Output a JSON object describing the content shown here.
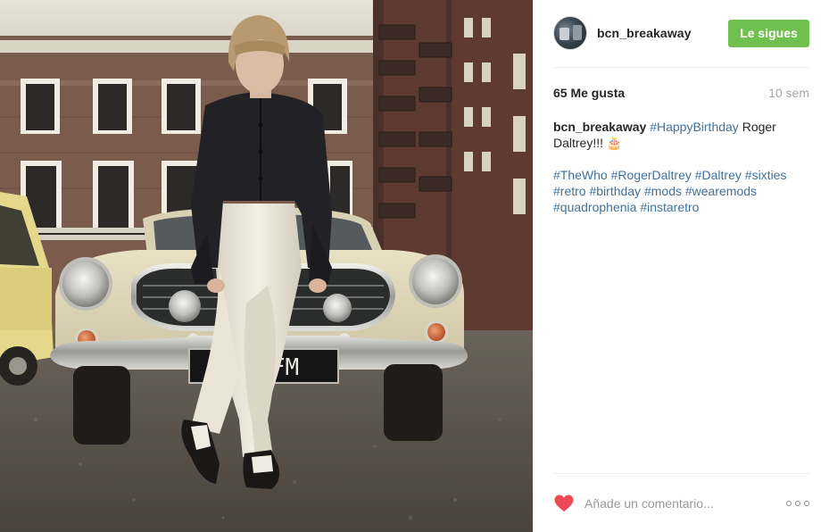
{
  "post": {
    "username": "bcn_breakaway",
    "follow_label": "Le sigues",
    "likes": "65 Me gusta",
    "time": "10 sem",
    "caption": {
      "author": "bcn_breakaway",
      "line1_tag": "#HappyBirthday",
      "line1_text": " Roger Daltrey!!! 🎂",
      "tags": [
        "#TheWho",
        "#RogerDaltrey",
        "#Daltrey",
        "#sixties",
        "#retro",
        "#birthday",
        "#mods",
        "#wearemods",
        "#quadrophenia",
        "#instaretro"
      ]
    },
    "comment_placeholder": "Añade un comentario...",
    "photo": {
      "plate_text": "8 YFM"
    }
  },
  "icons": {
    "like": "heart-icon",
    "more": "more-options-icon",
    "avatar": "profile-avatar"
  },
  "colors": {
    "follow_button": "#70c050",
    "hashtag": "#3f729b",
    "like_heart": "#ed4956",
    "meta_text": "#a5a7aa"
  }
}
